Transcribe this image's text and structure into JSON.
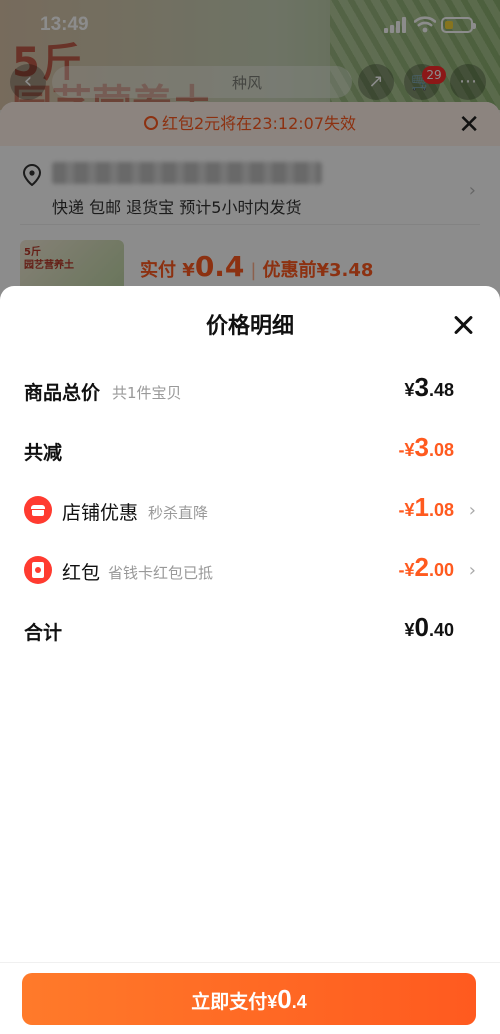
{
  "status_bar": {
    "time": "13:49"
  },
  "background_page": {
    "hero_line1": "5斤",
    "hero_line2": "园艺营养土",
    "search_hint": "种风",
    "cart_badge": "29",
    "countdown_text": "红包2元将在23:12:07失效",
    "address_services": "快递 包邮 退货宝 预计5小时内发货",
    "thumb_text": "5斤\n园艺营养土",
    "paid_label": "实付",
    "paid_currency": "¥",
    "paid_amount": "0.4",
    "before_label": "优惠前",
    "before_amount": "¥3.48"
  },
  "modal": {
    "title": "价格明细",
    "rows": [
      {
        "label": "商品总价",
        "sub": "共1件宝贝",
        "currency": "¥",
        "int": "3",
        "dec": ".48"
      },
      {
        "label": "共减",
        "currency": "-¥",
        "int": "3",
        "dec": ".08"
      },
      {
        "label": "店铺优惠",
        "sub": "秒杀直降",
        "currency": "-¥",
        "int": "1",
        "dec": ".08"
      },
      {
        "label": "红包",
        "sub": "省钱卡红包已抵",
        "currency": "-¥",
        "int": "2",
        "dec": ".00"
      },
      {
        "label": "合计",
        "currency": "¥",
        "int": "0",
        "dec": ".40"
      }
    ]
  },
  "pay_button": {
    "label": "立即支付",
    "currency": "¥",
    "int": "0",
    "dec": ".4"
  },
  "colors": {
    "accent": "#ff5a1f",
    "icon_red": "#ff3b30",
    "countdown_bg": "#fff1e8"
  }
}
